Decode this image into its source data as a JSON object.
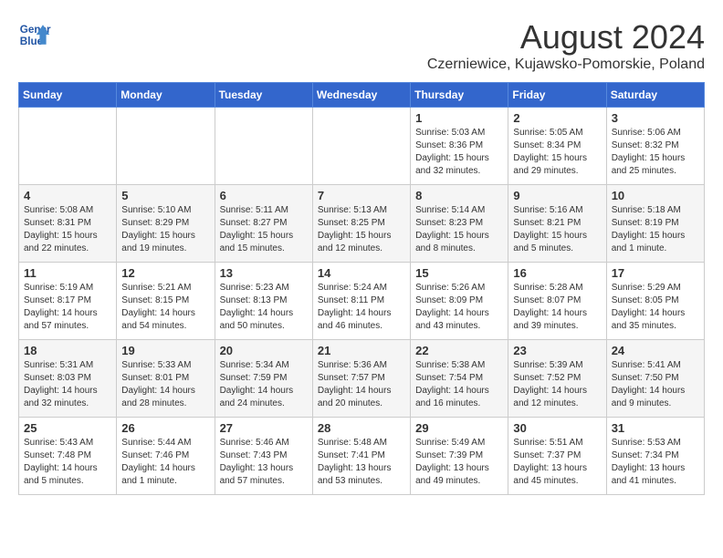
{
  "header": {
    "logo_line1": "General",
    "logo_line2": "Blue",
    "month_year": "August 2024",
    "location": "Czerniewice, Kujawsko-Pomorskie, Poland"
  },
  "weekdays": [
    "Sunday",
    "Monday",
    "Tuesday",
    "Wednesday",
    "Thursday",
    "Friday",
    "Saturday"
  ],
  "weeks": [
    [
      {
        "day": "",
        "detail": ""
      },
      {
        "day": "",
        "detail": ""
      },
      {
        "day": "",
        "detail": ""
      },
      {
        "day": "",
        "detail": ""
      },
      {
        "day": "1",
        "detail": "Sunrise: 5:03 AM\nSunset: 8:36 PM\nDaylight: 15 hours\nand 32 minutes."
      },
      {
        "day": "2",
        "detail": "Sunrise: 5:05 AM\nSunset: 8:34 PM\nDaylight: 15 hours\nand 29 minutes."
      },
      {
        "day": "3",
        "detail": "Sunrise: 5:06 AM\nSunset: 8:32 PM\nDaylight: 15 hours\nand 25 minutes."
      }
    ],
    [
      {
        "day": "4",
        "detail": "Sunrise: 5:08 AM\nSunset: 8:31 PM\nDaylight: 15 hours\nand 22 minutes."
      },
      {
        "day": "5",
        "detail": "Sunrise: 5:10 AM\nSunset: 8:29 PM\nDaylight: 15 hours\nand 19 minutes."
      },
      {
        "day": "6",
        "detail": "Sunrise: 5:11 AM\nSunset: 8:27 PM\nDaylight: 15 hours\nand 15 minutes."
      },
      {
        "day": "7",
        "detail": "Sunrise: 5:13 AM\nSunset: 8:25 PM\nDaylight: 15 hours\nand 12 minutes."
      },
      {
        "day": "8",
        "detail": "Sunrise: 5:14 AM\nSunset: 8:23 PM\nDaylight: 15 hours\nand 8 minutes."
      },
      {
        "day": "9",
        "detail": "Sunrise: 5:16 AM\nSunset: 8:21 PM\nDaylight: 15 hours\nand 5 minutes."
      },
      {
        "day": "10",
        "detail": "Sunrise: 5:18 AM\nSunset: 8:19 PM\nDaylight: 15 hours\nand 1 minute."
      }
    ],
    [
      {
        "day": "11",
        "detail": "Sunrise: 5:19 AM\nSunset: 8:17 PM\nDaylight: 14 hours\nand 57 minutes."
      },
      {
        "day": "12",
        "detail": "Sunrise: 5:21 AM\nSunset: 8:15 PM\nDaylight: 14 hours\nand 54 minutes."
      },
      {
        "day": "13",
        "detail": "Sunrise: 5:23 AM\nSunset: 8:13 PM\nDaylight: 14 hours\nand 50 minutes."
      },
      {
        "day": "14",
        "detail": "Sunrise: 5:24 AM\nSunset: 8:11 PM\nDaylight: 14 hours\nand 46 minutes."
      },
      {
        "day": "15",
        "detail": "Sunrise: 5:26 AM\nSunset: 8:09 PM\nDaylight: 14 hours\nand 43 minutes."
      },
      {
        "day": "16",
        "detail": "Sunrise: 5:28 AM\nSunset: 8:07 PM\nDaylight: 14 hours\nand 39 minutes."
      },
      {
        "day": "17",
        "detail": "Sunrise: 5:29 AM\nSunset: 8:05 PM\nDaylight: 14 hours\nand 35 minutes."
      }
    ],
    [
      {
        "day": "18",
        "detail": "Sunrise: 5:31 AM\nSunset: 8:03 PM\nDaylight: 14 hours\nand 32 minutes."
      },
      {
        "day": "19",
        "detail": "Sunrise: 5:33 AM\nSunset: 8:01 PM\nDaylight: 14 hours\nand 28 minutes."
      },
      {
        "day": "20",
        "detail": "Sunrise: 5:34 AM\nSunset: 7:59 PM\nDaylight: 14 hours\nand 24 minutes."
      },
      {
        "day": "21",
        "detail": "Sunrise: 5:36 AM\nSunset: 7:57 PM\nDaylight: 14 hours\nand 20 minutes."
      },
      {
        "day": "22",
        "detail": "Sunrise: 5:38 AM\nSunset: 7:54 PM\nDaylight: 14 hours\nand 16 minutes."
      },
      {
        "day": "23",
        "detail": "Sunrise: 5:39 AM\nSunset: 7:52 PM\nDaylight: 14 hours\nand 12 minutes."
      },
      {
        "day": "24",
        "detail": "Sunrise: 5:41 AM\nSunset: 7:50 PM\nDaylight: 14 hours\nand 9 minutes."
      }
    ],
    [
      {
        "day": "25",
        "detail": "Sunrise: 5:43 AM\nSunset: 7:48 PM\nDaylight: 14 hours\nand 5 minutes."
      },
      {
        "day": "26",
        "detail": "Sunrise: 5:44 AM\nSunset: 7:46 PM\nDaylight: 14 hours\nand 1 minute."
      },
      {
        "day": "27",
        "detail": "Sunrise: 5:46 AM\nSunset: 7:43 PM\nDaylight: 13 hours\nand 57 minutes."
      },
      {
        "day": "28",
        "detail": "Sunrise: 5:48 AM\nSunset: 7:41 PM\nDaylight: 13 hours\nand 53 minutes."
      },
      {
        "day": "29",
        "detail": "Sunrise: 5:49 AM\nSunset: 7:39 PM\nDaylight: 13 hours\nand 49 minutes."
      },
      {
        "day": "30",
        "detail": "Sunrise: 5:51 AM\nSunset: 7:37 PM\nDaylight: 13 hours\nand 45 minutes."
      },
      {
        "day": "31",
        "detail": "Sunrise: 5:53 AM\nSunset: 7:34 PM\nDaylight: 13 hours\nand 41 minutes."
      }
    ]
  ]
}
